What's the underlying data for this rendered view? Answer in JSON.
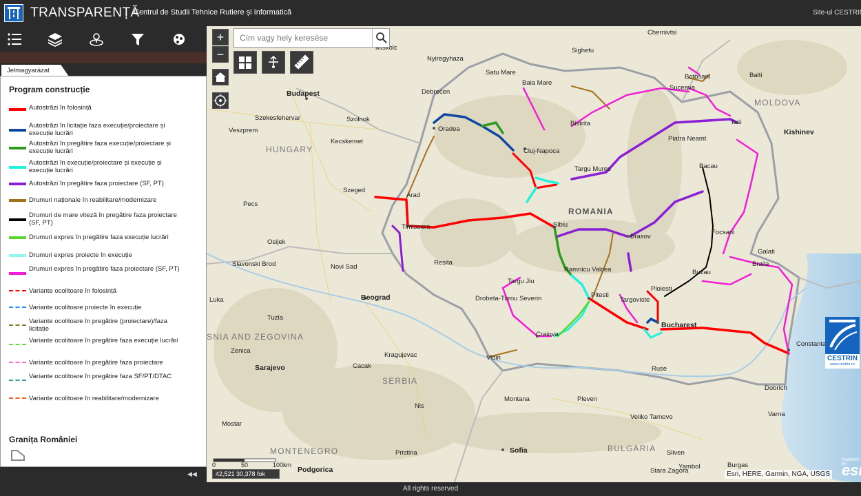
{
  "app": {
    "title": "TRANSPARENȚĂ",
    "org": "Centrul de Studii Tehnice Rutiere și Informatică",
    "site_link": "Site-ul CESTRIN"
  },
  "panel": {
    "toolbar_icons": [
      "legend-list-icon",
      "layers-icon",
      "basemap-location-icon",
      "filter-icon",
      "analysis-icon"
    ],
    "tab": "Jelmagyarázat",
    "legend_title": "Program construcție",
    "legend": [
      {
        "label": "Autostrăzi în folosință",
        "color": "#ff0000",
        "style": "solid"
      },
      {
        "label": "Autostrăzi în licitație faza execuție/proiectare și execuție lucrări",
        "color": "#0d47a1",
        "style": "solid"
      },
      {
        "label": "Autostrăzi în pregătire faza execuție/proiectare și execuție lucrări",
        "color": "#2e9b20",
        "style": "solid"
      },
      {
        "label": "Autostrăzi în execuție/proiectare și execuție și execuție lucrări",
        "color": "#22f2dc",
        "style": "solid"
      },
      {
        "label": "Autostrăzi în pregătire faza proiectare (SF, PT)",
        "color": "#8a1fd6",
        "style": "solid"
      },
      {
        "label": "Drumuri naționale în reabilitare/modernizare",
        "color": "#a6711d",
        "style": "solid"
      },
      {
        "label": "Drumuri de mare viteză în pregătire faza proiectare (SF, PT)",
        "color": "#000000",
        "style": "solid"
      },
      {
        "label": "Drumuri expres în pregătire faza execuție lucrări",
        "color": "#5ad62a",
        "style": "solid"
      },
      {
        "label": "Drumuri expres proiecte în execuție",
        "color": "#8ff7ee",
        "style": "solid"
      },
      {
        "label": "Drumuri expres în pregătire faza proiectare (SF, PT)",
        "color": "#f21ed6",
        "style": "solid"
      },
      {
        "label": "Variante ocolitoare în folosință",
        "color": "#ff0000",
        "style": "dash"
      },
      {
        "label": "Variante ocolitoare proiecte în execuție",
        "color": "#1e90ff",
        "style": "dash"
      },
      {
        "label": "Variante ocolitoare în pregătire (proiectare)/faza licitație",
        "color": "#8a7a30",
        "style": "dash"
      },
      {
        "label": "Variante ocolitoare în pregătire faza execuție lucrări",
        "color": "#66dd33",
        "style": "dash"
      },
      {
        "label": "Variante ocolitoare în pregătire faza proiectare",
        "color": "#ff66cc",
        "style": "dash"
      },
      {
        "label": "Variante ocolitoare în pregătire faza SF/PT/DTAC",
        "color": "#2aa198",
        "style": "dash"
      },
      {
        "label": "Variante ocolitoare în reabilitare/modernizare",
        "color": "#ff5a1e",
        "style": "dash"
      }
    ],
    "border_title": "Granița României"
  },
  "map": {
    "search_placeholder": "Cím vagy hely keresése",
    "map_tools": [
      "basemap-gallery-icon",
      "measure-point-icon",
      "ruler-icon"
    ],
    "countries": [
      "HUNGARY",
      "ROMANIA",
      "MOLDOVA",
      "SERBIA",
      "BULGARIA",
      "MONTENEGRO",
      "SNIA AND ZEGOVINA"
    ],
    "cities": [
      "Budapest",
      "Miskolc",
      "Nyiregyhaza",
      "Satu Mare",
      "Baia Mare",
      "Sighetu",
      "Chernivtsi",
      "Botosani",
      "Balti",
      "Suceava",
      "Debrecen",
      "Oradea",
      "Cluj-Napoca",
      "Bistrita",
      "Targu Mures",
      "Iasi",
      "Piatra Neamt",
      "Bacau",
      "Kishinev",
      "Szekesfehervar",
      "Szolnok",
      "Kecskemet",
      "Veszprem",
      "Szeged",
      "Arad",
      "Timisoara",
      "Pecs",
      "Osijek",
      "Novi Sad",
      "Slavonski Brod",
      "Resita",
      "Sibiu",
      "Brasov",
      "Focsani",
      "Galati",
      "Braila",
      "Ramnicu Valcea",
      "Targu Jiu",
      "Pitesti",
      "Targoviste",
      "Ploiesti",
      "Buzau",
      "Beograd",
      "Drobeta-Turnu Severin",
      "Craiova",
      "Bucharest",
      "Constanta",
      "Tuzla",
      "Zenica",
      "Sarajevo",
      "Kragujevac",
      "Cacak",
      "Vidin",
      "Ruse",
      "Dobrich",
      "Varna",
      "Luka",
      "Mostar",
      "Montana",
      "Pleven",
      "Nis",
      "Sofia",
      "Veliko Tarnovo",
      "Sliven",
      "Burgas",
      "Yambol",
      "Stara Zagora",
      "Pristina",
      "Podgorica"
    ],
    "scale": {
      "labels": [
        "0",
        "50",
        "100km"
      ]
    },
    "coords": "42,521 30,378 fok",
    "attribution": "Esri, HERE, Garmin, NGA, USGS",
    "esri": "esri",
    "powered": "POWERED BY",
    "cestrin": {
      "name": "CESTRIN",
      "url": "www.cestrin.ro"
    }
  },
  "footer": "All rights reserved"
}
